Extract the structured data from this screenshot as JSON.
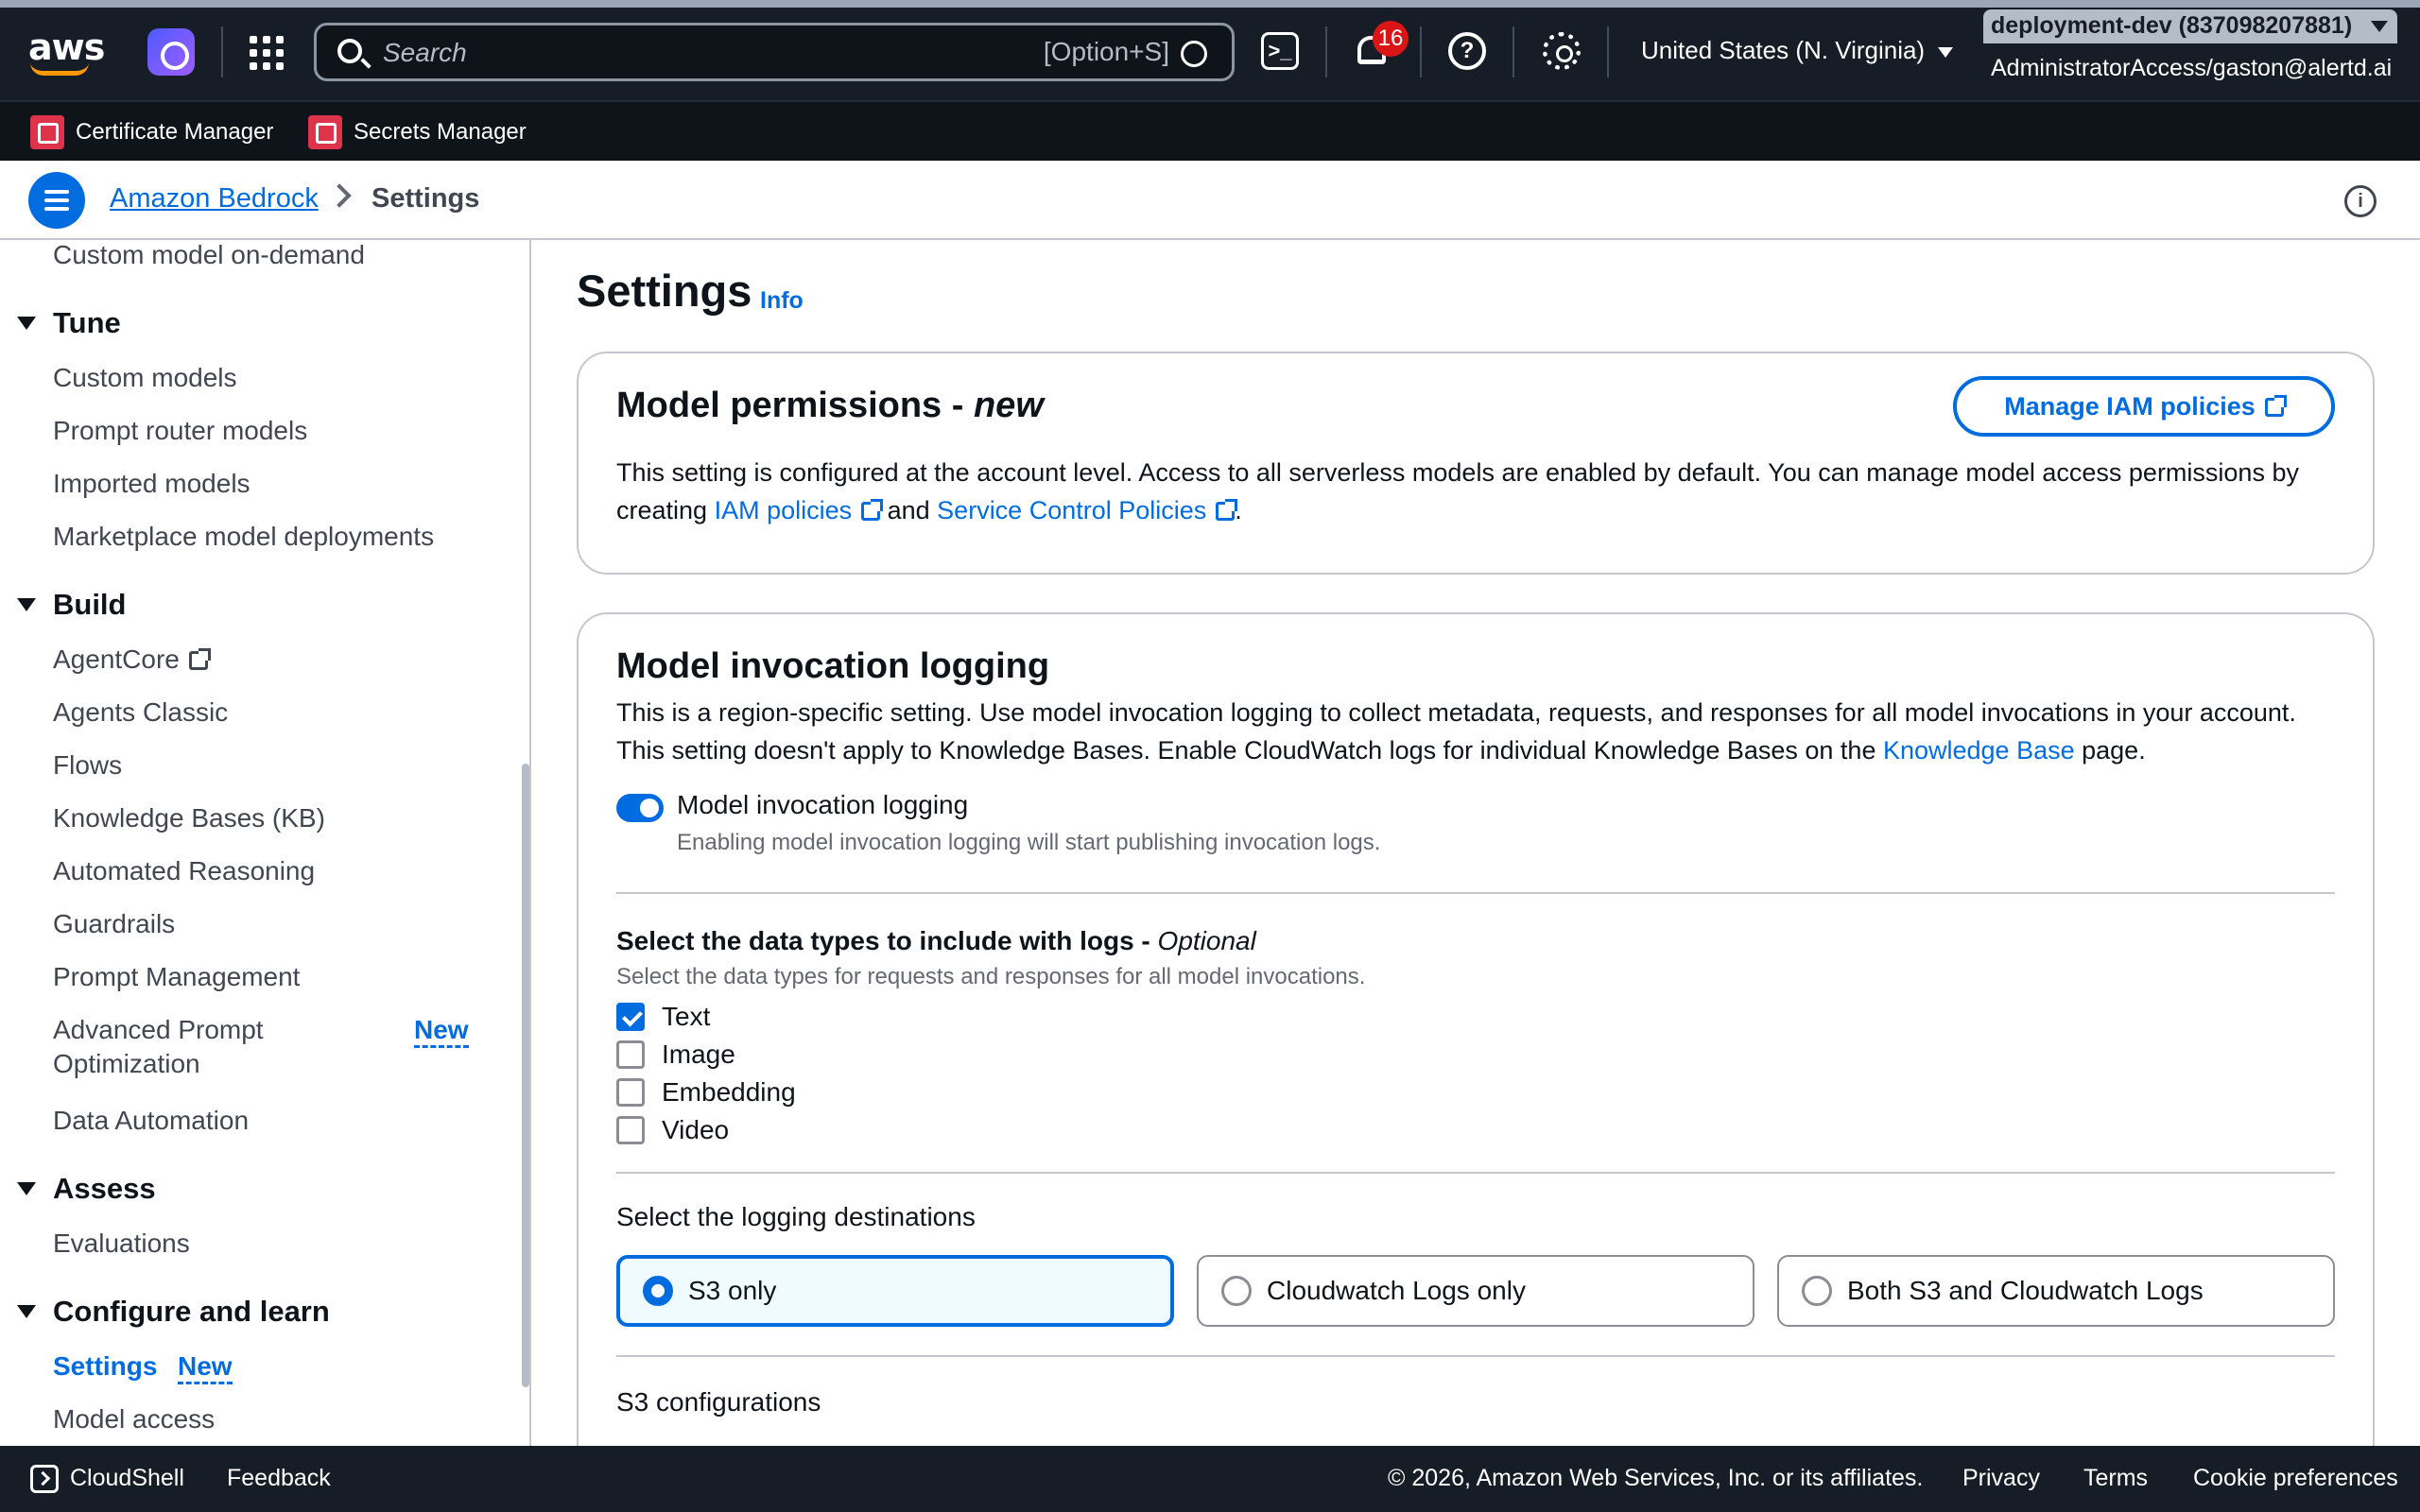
{
  "topnav": {
    "logo_text": "aws",
    "search_placeholder": "Search",
    "search_shortcut": "[Option+S]",
    "notifications_count": "16",
    "help_glyph": "?",
    "cloudshell_glyph": ">_",
    "region": "United States (N. Virginia)",
    "account": "deployment-dev (837098207881)",
    "role": "AdministratorAccess/gaston@alertd.ai"
  },
  "favorites": [
    {
      "label": "Certificate Manager"
    },
    {
      "label": "Secrets Manager"
    }
  ],
  "breadcrumb": {
    "service": "Amazon Bedrock",
    "current": "Settings",
    "info_glyph": "i"
  },
  "sidebar": {
    "top_item": "Custom model on-demand",
    "tune": {
      "label": "Tune",
      "items": [
        "Custom models",
        "Prompt router models",
        "Imported models",
        "Marketplace model deployments"
      ]
    },
    "build": {
      "label": "Build",
      "items": [
        "AgentCore",
        "Agents Classic",
        "Flows",
        "Knowledge Bases (KB)",
        "Automated Reasoning",
        "Guardrails",
        "Prompt Management",
        "Advanced Prompt",
        "Optimization",
        "Data Automation"
      ],
      "new_badge": "New"
    },
    "assess": {
      "label": "Assess",
      "items": [
        "Evaluations"
      ]
    },
    "configure": {
      "label": "Configure and learn",
      "items": [
        "Settings",
        "Model access"
      ],
      "new_badge": "New"
    }
  },
  "main": {
    "title": "Settings",
    "title_info": "Info",
    "permissions": {
      "heading": "Model permissions - ",
      "heading_em": "new",
      "button": "Manage IAM policies",
      "text_1": "This setting is configured at the account level. Access to all serverless models are enabled by default. You can manage model access permissions by creating ",
      "link_1": "IAM policies",
      "text_2": " and ",
      "link_2": "Service Control Policies",
      "text_3": "."
    },
    "logging": {
      "heading": "Model invocation logging",
      "text_1": "This is a region-specific setting. Use model invocation logging to collect metadata, requests, and responses for all model invocations in your account. This setting doesn't apply to Knowledge Bases. Enable CloudWatch logs for individual Knowledge Bases on the ",
      "link": "Knowledge Base",
      "text_2": " page.",
      "toggle_label": "Model invocation logging",
      "toggle_desc": "Enabling model invocation logging will start publishing invocation logs.",
      "data_types_label": "Select the data types to include with logs - ",
      "data_types_optional": "Optional",
      "data_types_desc": "Select the data types for requests and responses for all model invocations.",
      "data_types": [
        {
          "label": "Text",
          "checked": true
        },
        {
          "label": "Image",
          "checked": false
        },
        {
          "label": "Embedding",
          "checked": false
        },
        {
          "label": "Video",
          "checked": false
        }
      ],
      "dest_label": "Select the logging destinations",
      "destinations": [
        {
          "label": "S3 only",
          "selected": true
        },
        {
          "label": "Cloudwatch Logs only",
          "selected": false
        },
        {
          "label": "Both S3 and Cloudwatch Logs",
          "selected": false
        }
      ],
      "s3_label": "S3 configurations"
    }
  },
  "footer": {
    "cloudshell": "CloudShell",
    "feedback": "Feedback",
    "copyright": "© 2026, Amazon Web Services, Inc. or its affiliates.",
    "privacy": "Privacy",
    "terms": "Terms",
    "cookies": "Cookie preferences"
  }
}
